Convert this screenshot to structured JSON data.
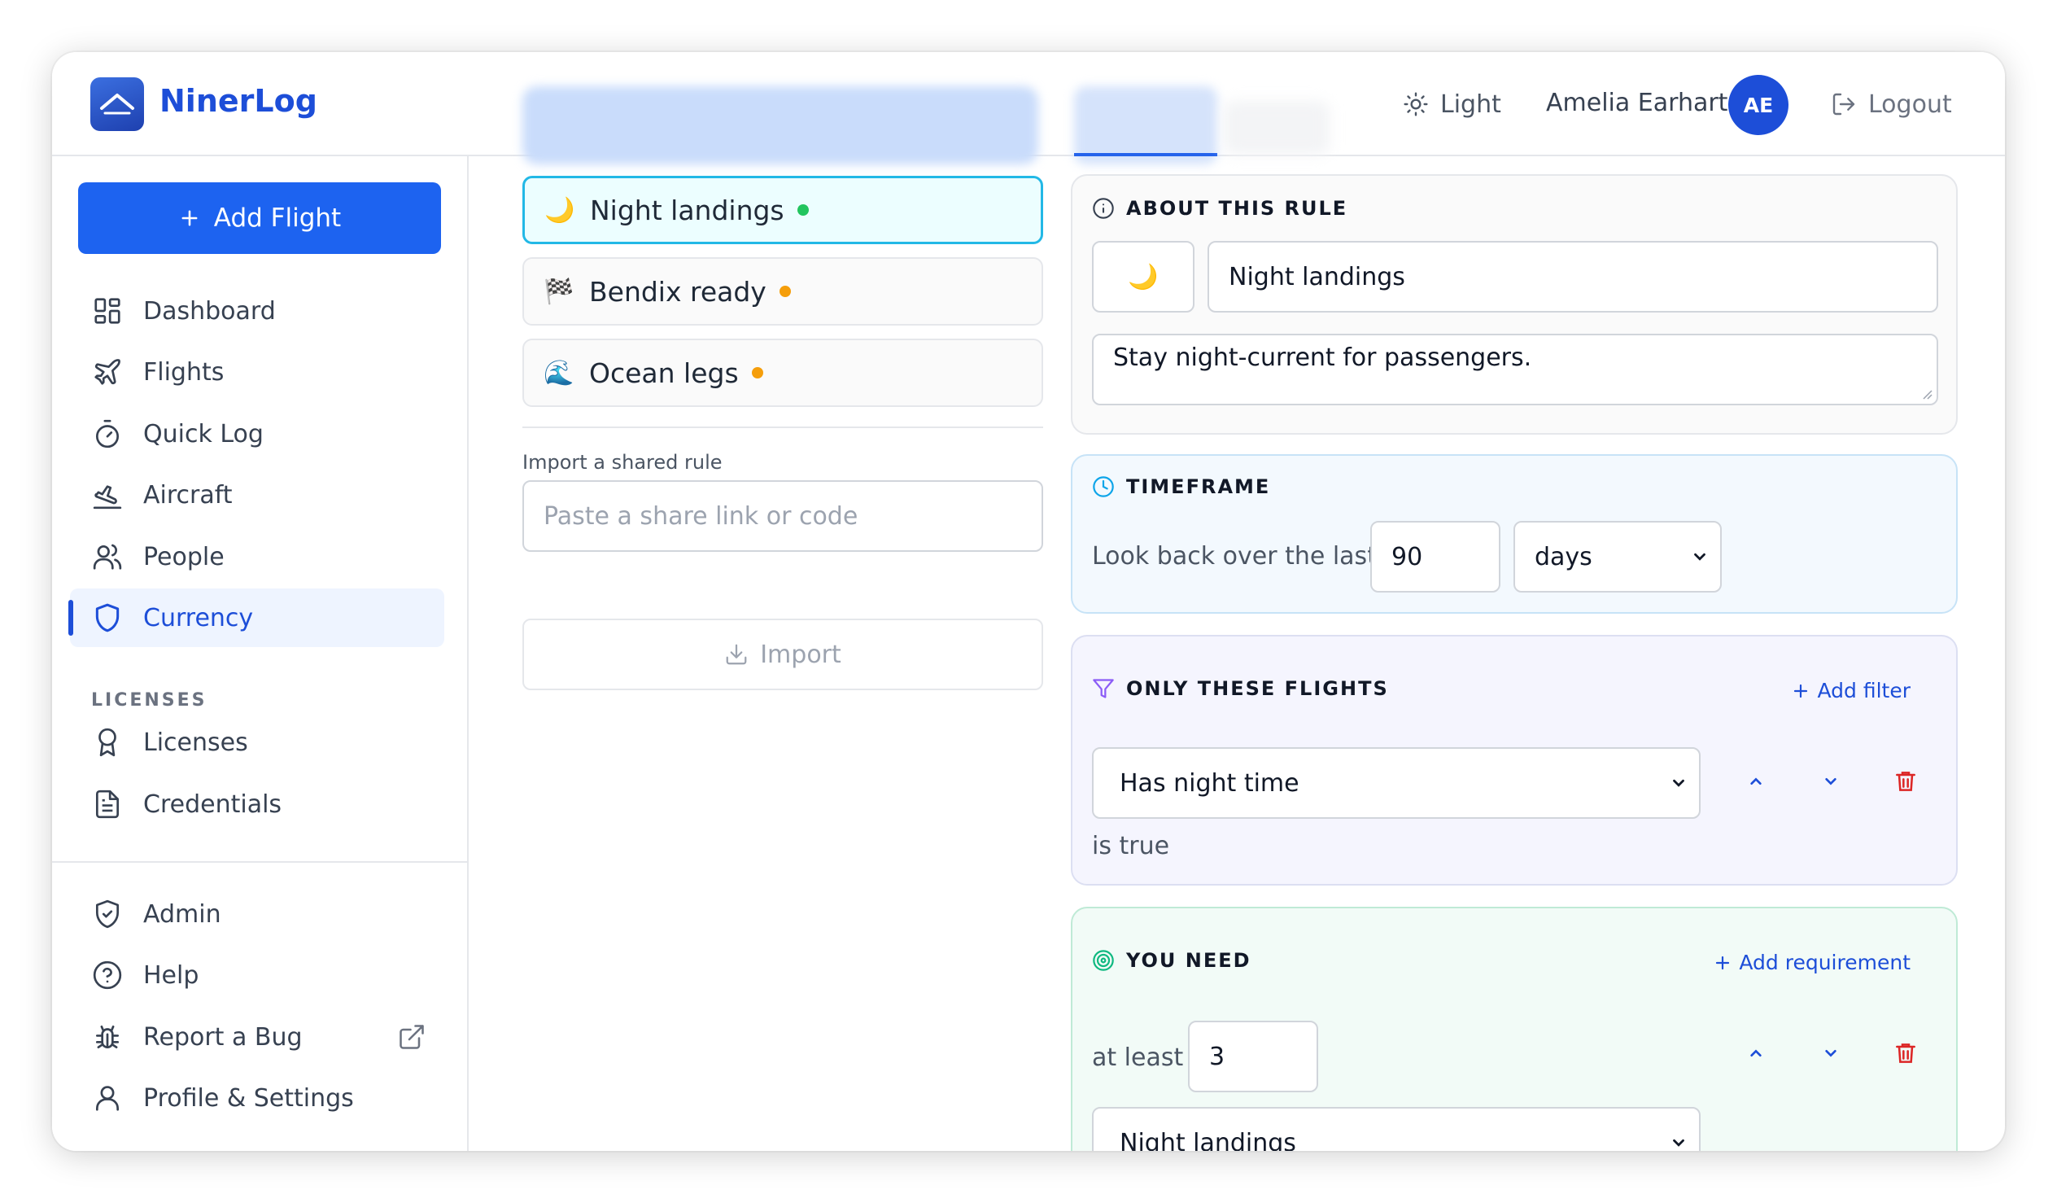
{
  "app": {
    "name": "NinerLog"
  },
  "header": {
    "theme_label": "Light",
    "user_name": "Amelia Earhart",
    "avatar_initials": "AE",
    "logout_label": "Logout"
  },
  "sidebar": {
    "add_flight": "Add Flight",
    "items": [
      {
        "label": "Dashboard",
        "icon": "grid-icon"
      },
      {
        "label": "Flights",
        "icon": "plane-icon"
      },
      {
        "label": "Quick Log",
        "icon": "stopwatch-icon"
      },
      {
        "label": "Aircraft",
        "icon": "plane-landing-icon"
      },
      {
        "label": "People",
        "icon": "users-icon"
      },
      {
        "label": "Currency",
        "icon": "shield-icon",
        "active": true
      }
    ],
    "licenses_heading": "LICENSES",
    "license_items": [
      {
        "label": "Licenses",
        "icon": "award-icon"
      },
      {
        "label": "Credentials",
        "icon": "document-icon"
      }
    ],
    "bottom_items": [
      {
        "label": "Admin",
        "icon": "shield-check-icon"
      },
      {
        "label": "Help",
        "icon": "help-icon"
      },
      {
        "label": "Report a Bug",
        "icon": "bug-icon"
      },
      {
        "label": "Profile & Settings",
        "icon": "user-icon"
      }
    ]
  },
  "rules": [
    {
      "emoji": "🌙",
      "name": "Night landings",
      "status_color": "#22c55e",
      "selected": true
    },
    {
      "emoji": "🏁",
      "name": "Bendix ready",
      "status_color": "#f59e0b"
    },
    {
      "emoji": "🌊",
      "name": "Ocean legs",
      "status_color": "#f59e0b"
    }
  ],
  "import": {
    "label": "Import a shared rule",
    "placeholder": "Paste a share link or code",
    "button": "Import"
  },
  "about": {
    "title": "ABOUT THIS RULE",
    "emoji": "🌙",
    "name": "Night landings",
    "description": "Stay night-current for passengers."
  },
  "timeframe": {
    "title": "TIMEFRAME",
    "label": "Look back over the last",
    "value": "90",
    "unit": "days"
  },
  "filters": {
    "title": "ONLY THESE FLIGHTS",
    "add_label": "Add filter",
    "field": "Has night time",
    "condition": "is true"
  },
  "requirements": {
    "title": "YOU NEED",
    "add_label": "Add requirement",
    "prefix": "at least",
    "count": "3",
    "metric": "Night landings"
  },
  "colors": {
    "accent": "#1d4ed8",
    "primary_button": "#1d63f0",
    "danger": "#dc2626",
    "selected_border": "#22b8e6"
  }
}
